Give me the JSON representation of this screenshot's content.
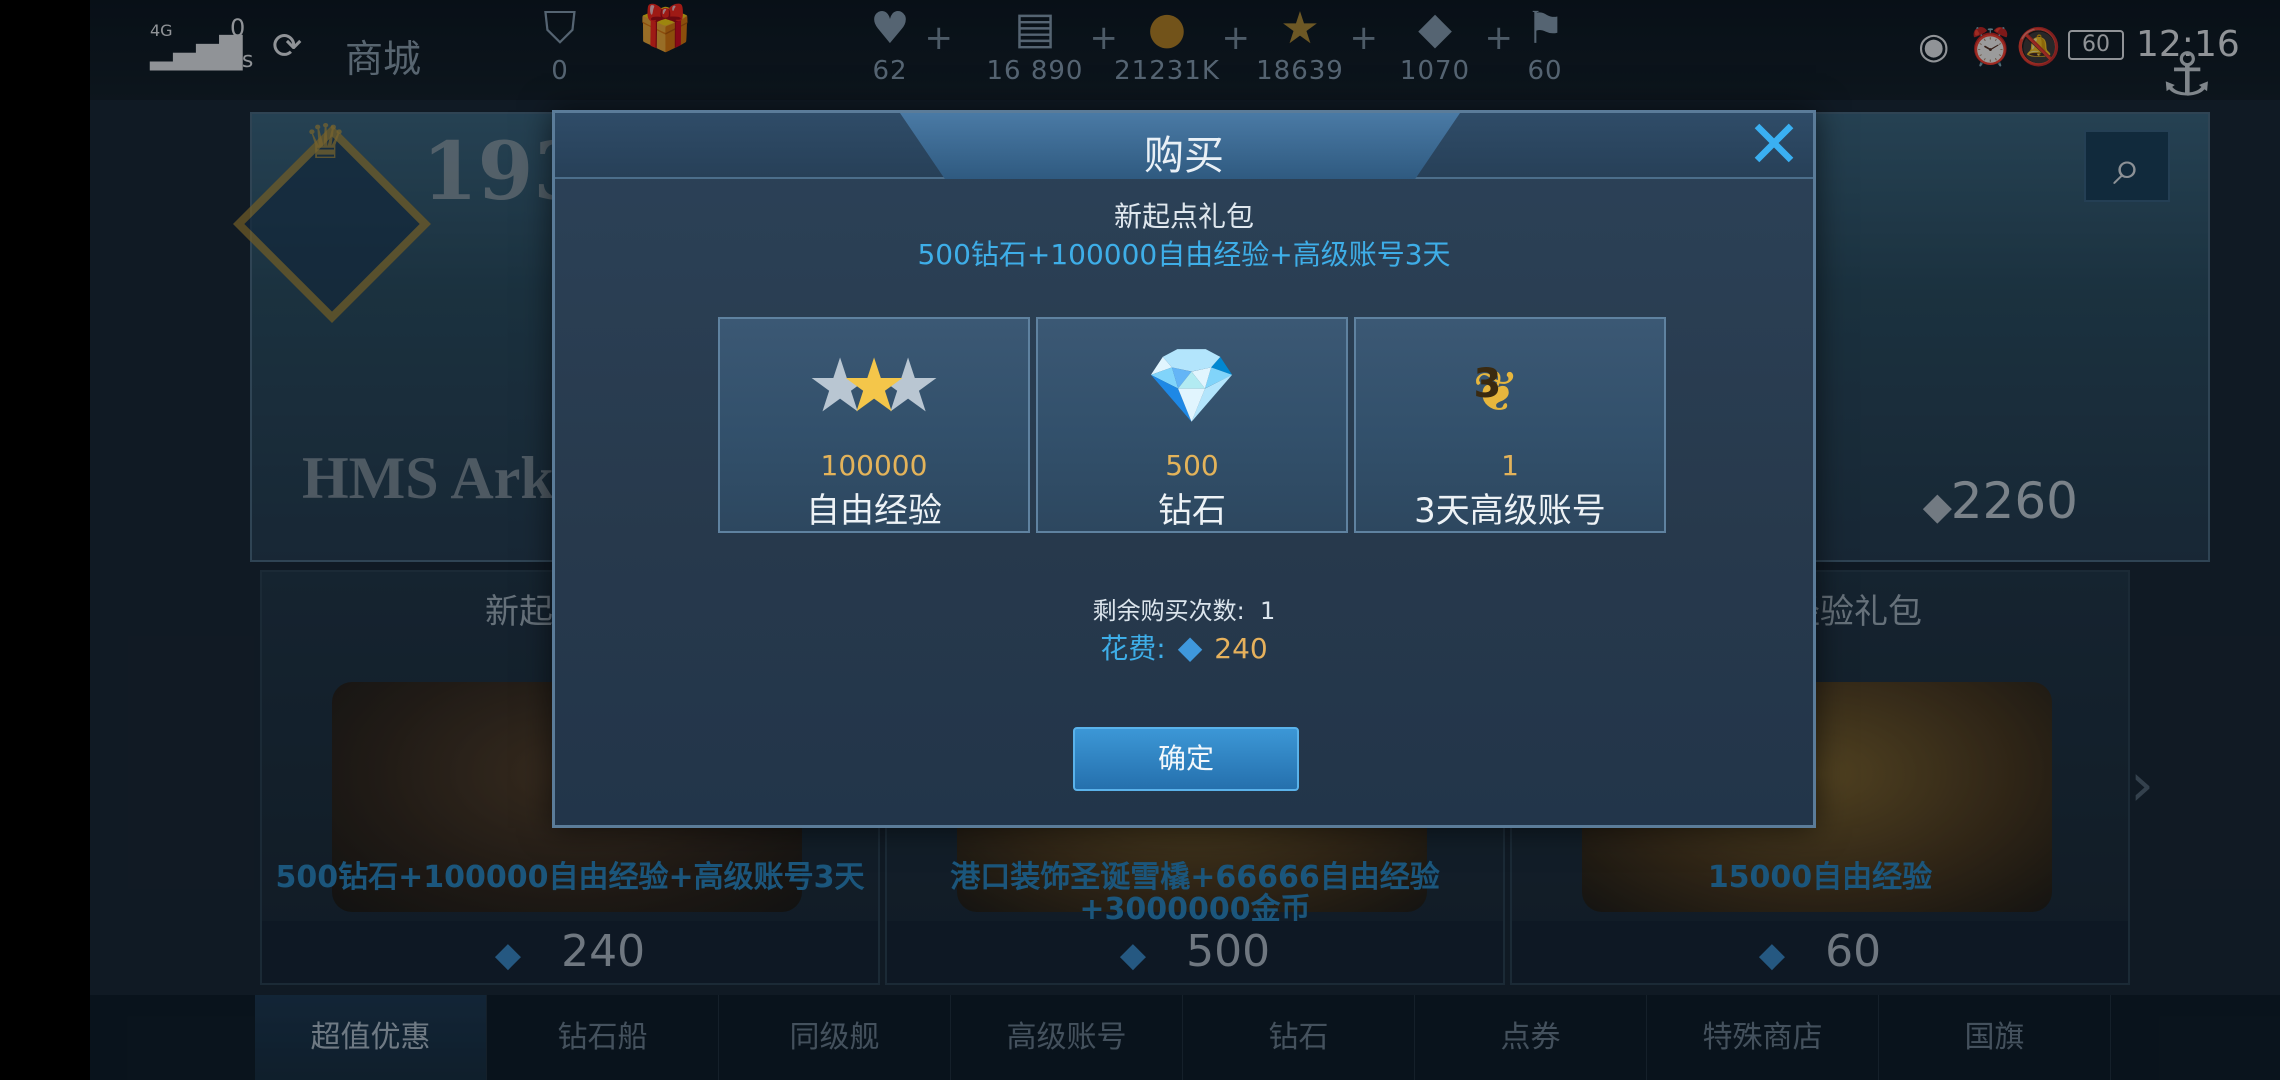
{
  "status": {
    "net_type": "4G",
    "net_speed_value": "0",
    "net_speed_unit": "K/s",
    "battery": "60",
    "time": "12:16"
  },
  "header": {
    "title": "商城",
    "resources": [
      {
        "icon": "medal-icon",
        "value": "0"
      },
      {
        "icon": "gift-icon",
        "value": ""
      },
      {
        "icon": "heart-icon",
        "value": "62"
      },
      {
        "icon": "card-icon",
        "value": "16 890"
      },
      {
        "icon": "coin-icon",
        "value": "21231K"
      },
      {
        "icon": "star-icon",
        "value": "18639"
      },
      {
        "icon": "diamond-icon",
        "value": "1070"
      },
      {
        "icon": "flag-icon",
        "value": "60"
      }
    ]
  },
  "hero": {
    "year": "193",
    "ship_name": "HMS Ark Royal",
    "price": "2260"
  },
  "cards": [
    {
      "title": "新起点礼包",
      "desc": "500钻石+100000自由经验+高级账号3天",
      "price": "240"
    },
    {
      "title": "",
      "desc": "港口装饰圣诞雪橇+66666自由经验+3000000金币",
      "price": "500"
    },
    {
      "title": "自由经验礼包",
      "desc": "15000自由经验",
      "price": "60"
    }
  ],
  "tabs": [
    "超值优惠",
    "钻石船",
    "同级舰",
    "高级账号",
    "钻石",
    "点券",
    "特殊商店",
    "国旗"
  ],
  "dialog": {
    "title": "购买",
    "close": "✕",
    "pack_name": "新起点礼包",
    "pack_desc": "500钻石+100000自由经验+高级账号3天",
    "items": [
      {
        "icon": "star-wings-icon",
        "amount": "100000",
        "name": "自由经验"
      },
      {
        "icon": "diamond-icon",
        "amount": "500",
        "name": "钻石"
      },
      {
        "icon": "laurel-3-icon",
        "badge": "3",
        "amount": "1",
        "name": "3天高级账号"
      }
    ],
    "remaining_label": "剩余购买次数:",
    "remaining_value": "1",
    "cost_label": "花费:",
    "cost_value": "240",
    "confirm": "确定"
  }
}
